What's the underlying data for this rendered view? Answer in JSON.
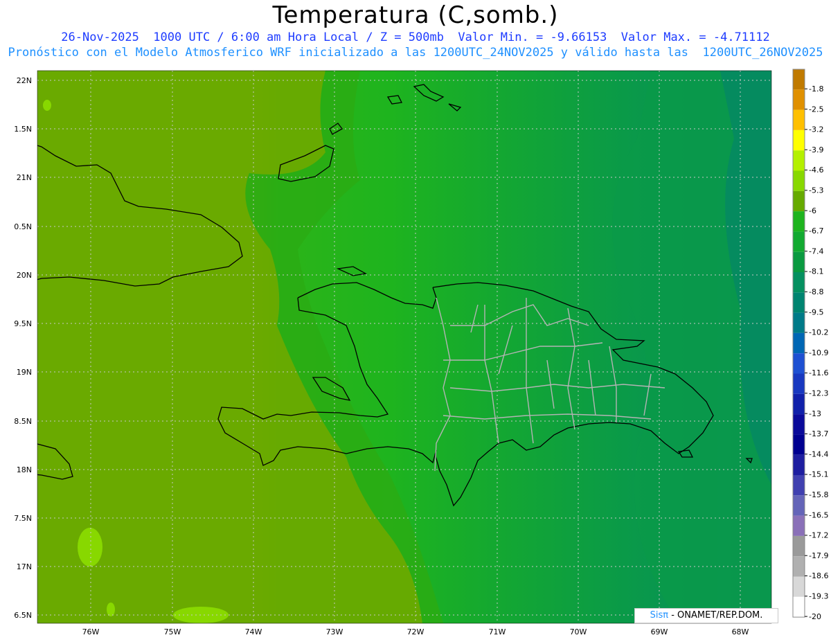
{
  "header": {
    "title": "Temperatura (C,somb.)",
    "line1": "26-Nov-2025  1000 UTC / 6:00 am Hora Local / Z = 500mb  Valor Min. = -9.66153  Valor Max. = -4.71112",
    "line2": "Pronóstico con el Modelo Atmosferico WRF inicializado a las 1200UTC_24NOV2025 y válido hasta las  1200UTC_26NOV2025"
  },
  "axes": {
    "lat_labels": [
      "22N",
      "1.5N",
      "21N",
      "0.5N",
      "20N",
      "9.5N",
      "19N",
      "8.5N",
      "18N",
      "7.5N",
      "17N",
      "6.5N"
    ],
    "lon_labels": [
      "76W",
      "75W",
      "74W",
      "73W",
      "72W",
      "71W",
      "70W",
      "69W",
      "68W"
    ]
  },
  "colorbar": {
    "labels": [
      "-1.8",
      "-2.5",
      "-3.2",
      "-3.9",
      "-4.6",
      "-5.3",
      "-6",
      "-6.7",
      "-7.4",
      "-8.1",
      "-8.8",
      "-9.5",
      "-10.2",
      "-10.9",
      "-11.6",
      "-12.3",
      "-13",
      "-13.7",
      "-14.4",
      "-15.1",
      "-15.8",
      "-16.5",
      "-17.2",
      "-17.9",
      "-18.6",
      "-19.3",
      "-20"
    ],
    "colors": [
      "#c07a00",
      "#e09000",
      "#ffc000",
      "#ffff00",
      "#b4f000",
      "#88d800",
      "#66aa00",
      "#1eb41e",
      "#12aa30",
      "#0a9a40",
      "#059060",
      "#008470",
      "#007a88",
      "#0066b4",
      "#1e50d2",
      "#1838c0",
      "#1020aa",
      "#0a0a9a",
      "#000090",
      "#1e1ea0",
      "#4040b0",
      "#6464b8",
      "#8a70b8",
      "#9a9a9a",
      "#b0b0b0",
      "#d8d8d8",
      "#ffffff"
    ]
  },
  "field_colors": {
    "west": "#6aaa00",
    "central": "#1eb41e",
    "east": "#12a040",
    "far_east": "#059060",
    "warm_spot": "#88d800"
  },
  "credit": {
    "brand": "Sisπ",
    "text": " - ONAMET/REP.DOM."
  }
}
